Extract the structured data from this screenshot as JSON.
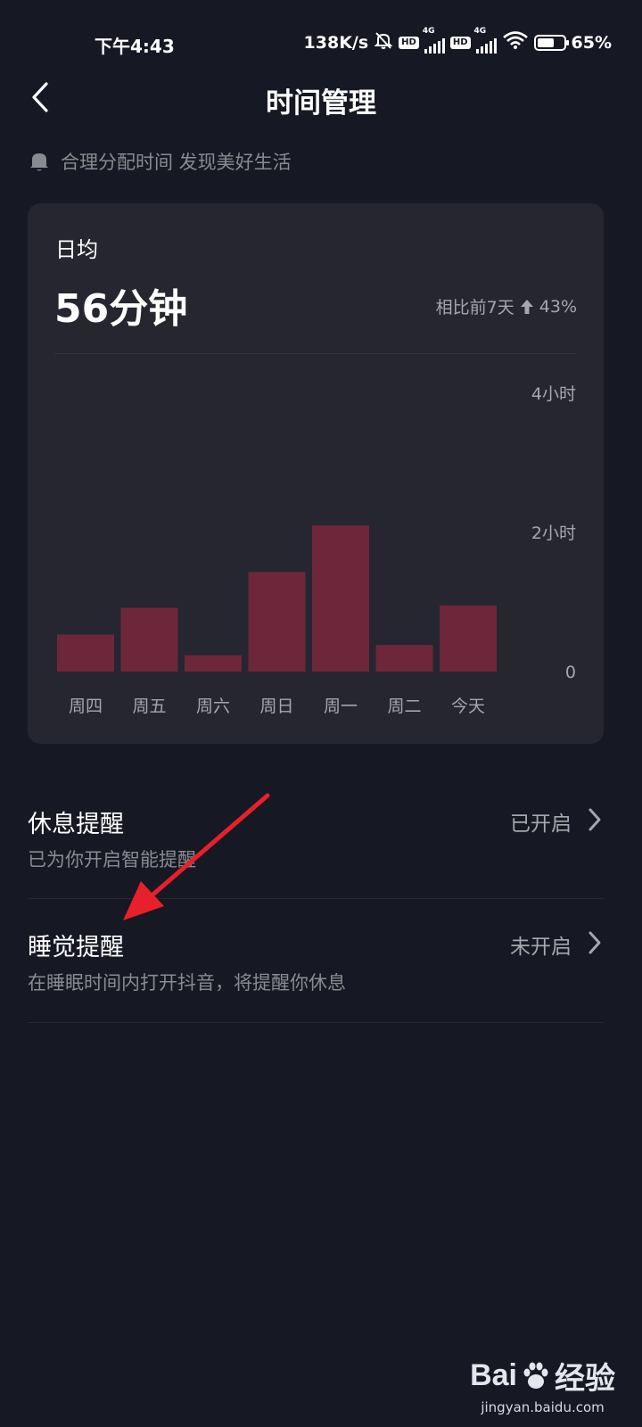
{
  "status_bar": {
    "time": "下午4:43",
    "net_speed": "138K/s",
    "sim1_badge": "HD",
    "sim1_network": "4G",
    "sim2_badge": "HD",
    "sim2_network": "4G",
    "battery_percent": "65%",
    "battery_level": 0.65,
    "icons": [
      "mute-icon",
      "signal-icon",
      "wifi-icon",
      "battery-icon"
    ]
  },
  "header": {
    "title": "时间管理",
    "back_icon": "chevron-left-icon"
  },
  "tip": {
    "icon": "bell-icon",
    "text": "合理分配时间 发现美好生活"
  },
  "usage_card": {
    "avg_label": "日均",
    "avg_value": "56分钟",
    "compare_label": "相比前7天",
    "compare_icon": "arrow-up-icon",
    "compare_value": "43%"
  },
  "chart_data": {
    "type": "bar",
    "categories": [
      "周四",
      "周五",
      "周六",
      "周日",
      "周一",
      "周二",
      "今天"
    ],
    "values": [
      32,
      55,
      14,
      86,
      126,
      23,
      57
    ],
    "value_unit": "minutes",
    "ylim": [
      0,
      240
    ],
    "ytick_values": [
      0,
      120,
      240
    ],
    "ytick_labels": [
      "0",
      "2小时",
      "4小时"
    ],
    "bar_color": "#6e263b",
    "grid": false
  },
  "settings": [
    {
      "title": "休息提醒",
      "desc": "已为你开启智能提醒",
      "status": "已开启",
      "icon": "chevron-right-icon"
    },
    {
      "title": "睡觉提醒",
      "desc": "在睡眠时间内打开抖音，将提醒你休息",
      "status": "未开启",
      "icon": "chevron-right-icon"
    }
  ],
  "annotation": {
    "color": "#e8202a"
  },
  "watermark": {
    "logo_text_left": "Bai",
    "logo_text_right": "经验",
    "url": "jingyan.baidu.com"
  },
  "colors": {
    "background": "#161823",
    "card": "#252630",
    "secondary_text": "#8a8b91"
  }
}
